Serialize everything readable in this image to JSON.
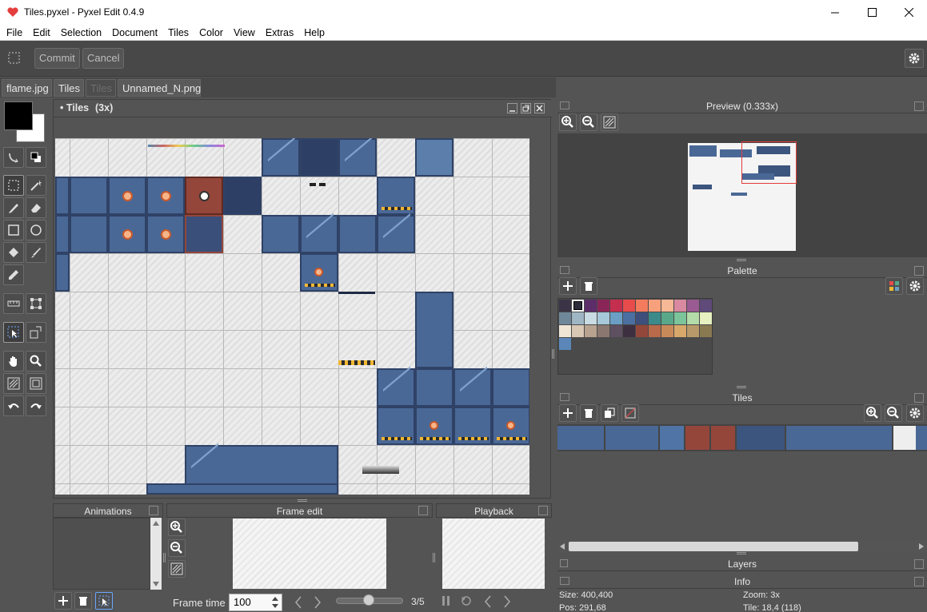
{
  "window": {
    "title": "Tiles.pyxel - Pyxel Edit 0.4.9",
    "minimize_icon": "minimize-icon",
    "maximize_icon": "maximize-icon",
    "close_icon": "close-icon"
  },
  "menu": [
    "File",
    "Edit",
    "Selection",
    "Document",
    "Tiles",
    "Color",
    "View",
    "Extras",
    "Help"
  ],
  "toolbar": {
    "commit": "Commit",
    "cancel": "Cancel"
  },
  "tabs": [
    {
      "label": "flame.jpg",
      "active": false
    },
    {
      "label": "Tiles",
      "active": true
    },
    {
      "label": "Tiles",
      "dim": true
    },
    {
      "label": "Unnamed_N.png",
      "active": false
    }
  ],
  "document": {
    "title": "• Tiles",
    "zoom": "(3x)"
  },
  "panels": {
    "preview": "Preview (0.333x)",
    "palette": "Palette",
    "tiles": "Tiles",
    "layers": "Layers",
    "info": "Info",
    "animations": "Animations",
    "frame_edit": "Frame edit",
    "playback": "Playback"
  },
  "frame": {
    "time_label": "Frame time",
    "time_value": "100",
    "counter": "3/5"
  },
  "info": {
    "size": "Size: 400,400",
    "pos": "Pos: 291,68",
    "zoom": "Zoom: 3x",
    "tile": "Tile: 18,4 (118)"
  },
  "palette_colors": [
    "#3b3446",
    "#ffffff",
    "#5d2d6a",
    "#8a2657",
    "#c42e4f",
    "#e84b4b",
    "#f37b5e",
    "#f7a07c",
    "#f6b896",
    "#d98aa0",
    "#9a5a92",
    "#5f4a7a",
    "#6f8899",
    "#9fb6c4",
    "#c9dbe3",
    "#a6c8d8",
    "#6b9ec4",
    "#4a6fa0",
    "#3d4f7a",
    "#3d8a8a",
    "#5aa88a",
    "#7cc49a",
    "#b4dca8",
    "#e6f0c0",
    "#efe6d6",
    "#d8c8b4",
    "#b8a290",
    "#8a7870",
    "#5e5060",
    "#3d2f40",
    "#93473a",
    "#b86a4a",
    "#c98a5a",
    "#d8a86a",
    "#b89a6a",
    "#8a7a52",
    "#5a87b8"
  ],
  "colors": {
    "primary": "#000000",
    "secondary": "#ffffff",
    "accent_red": "#e33d3d"
  }
}
